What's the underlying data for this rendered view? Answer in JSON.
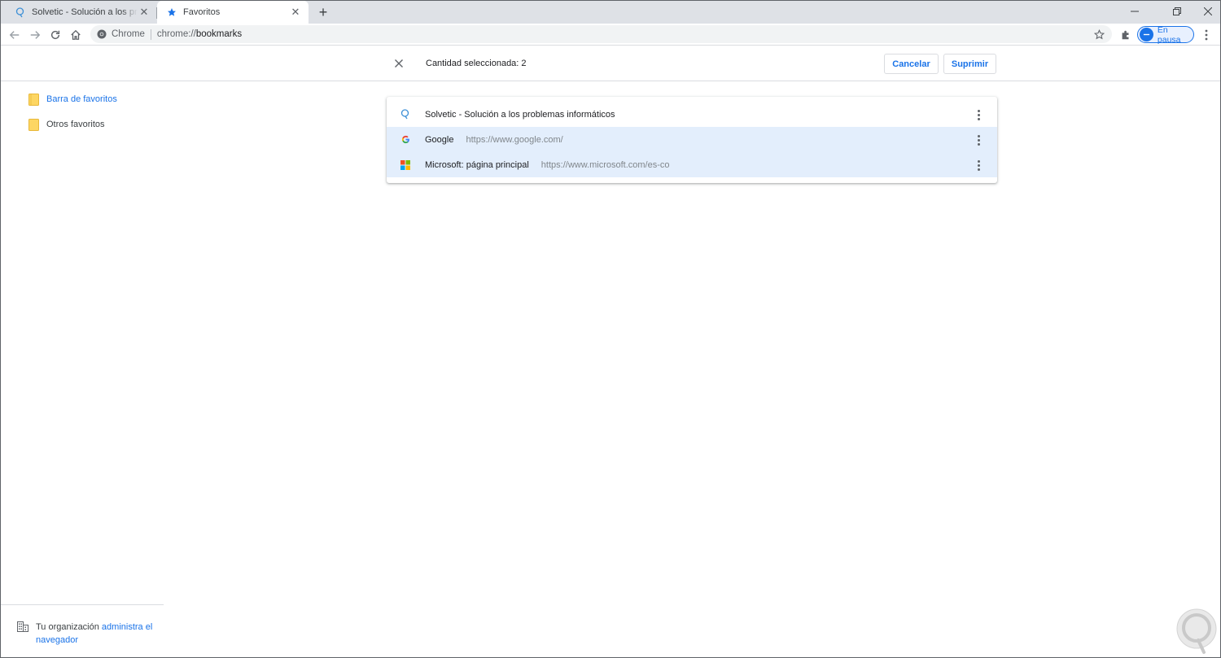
{
  "browser": {
    "tabs": [
      {
        "title": "Solvetic - Solución a los problemas informáticos",
        "active": false
      },
      {
        "title": "Favoritos",
        "active": true
      }
    ],
    "omnibox": {
      "origin": "Chrome",
      "scheme": "chrome://",
      "host": "bookmarks"
    },
    "profile_label": "En pausa"
  },
  "selection_toolbar": {
    "count_text": "Cantidad seleccionada: 2",
    "cancel_label": "Cancelar",
    "delete_label": "Suprimir"
  },
  "sidebar": {
    "folders": [
      {
        "label": "Barra de favoritos",
        "selected": true
      },
      {
        "label": "Otros favoritos",
        "selected": false
      }
    ],
    "management": {
      "prefix": "Tu organización ",
      "link": "administra el navegador"
    }
  },
  "bookmarks": [
    {
      "title": "Solvetic - Solución a los problemas informáticos",
      "url": "",
      "selected": false,
      "icon": "solvetic-icon"
    },
    {
      "title": "Google",
      "url": "https://www.google.com/",
      "selected": true,
      "icon": "google-icon"
    },
    {
      "title": "Microsoft: página principal",
      "url": "https://www.microsoft.com/es-co",
      "selected": true,
      "icon": "microsoft-icon"
    }
  ],
  "colors": {
    "accent": "#1a73e8",
    "selected_row": "#e3eefc",
    "folder": "#fdd663",
    "tabstrip": "#dee1e6"
  }
}
